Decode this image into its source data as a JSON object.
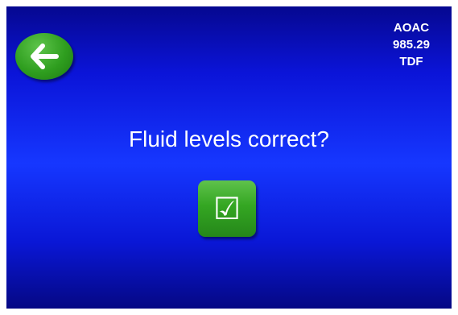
{
  "header": {
    "back_icon": "arrow-left-icon",
    "method_lines": [
      "AOAC",
      "985.29",
      "TDF"
    ]
  },
  "main": {
    "prompt": "Fluid levels correct?",
    "confirm_glyph": "☑",
    "confirm_icon": "checkbox-checked-icon"
  },
  "colors": {
    "background_top": "#060890",
    "background_mid": "#1637ff",
    "background_bottom": "#050884",
    "button_green": "#34a622",
    "text": "#ffffff"
  }
}
